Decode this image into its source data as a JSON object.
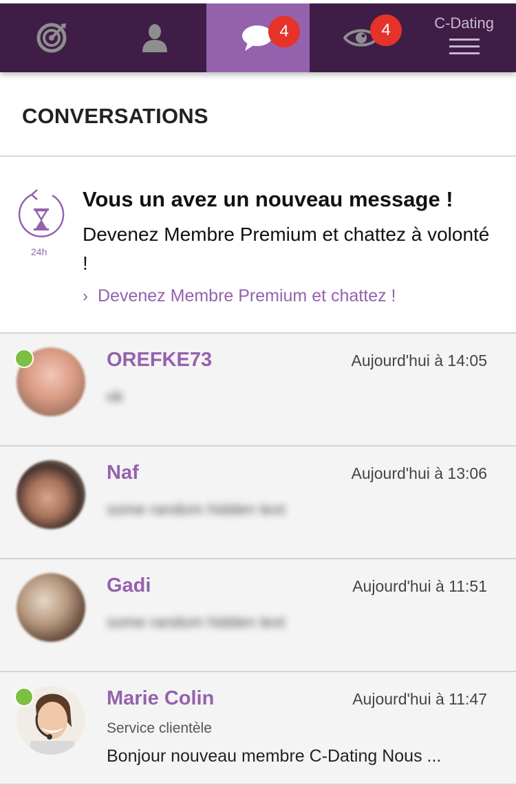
{
  "nav": {
    "brand": "C-Dating",
    "items": [
      {
        "icon": "target-icon",
        "active": false
      },
      {
        "icon": "profile-icon",
        "active": false
      },
      {
        "icon": "chat-icon",
        "active": true,
        "badge": "4"
      },
      {
        "icon": "eye-icon",
        "active": false,
        "badge": "4"
      },
      {
        "icon": "menu-icon",
        "active": false
      }
    ]
  },
  "section": {
    "title": "CONVERSATIONS"
  },
  "promo": {
    "timer_label": "24h",
    "title": "Vous un avez un nouveau message !",
    "text": "Devenez Membre Premium et chattez à volonté !",
    "link": "Devenez Membre Premium et chattez !"
  },
  "conversations": [
    {
      "name": "OREFKE73",
      "time": "Aujourd'hui à 14:05",
      "preview": "ok",
      "online": true
    },
    {
      "name": "Naf",
      "time": "Aujourd'hui à 13:06",
      "preview": "some random hidden text",
      "online": false
    },
    {
      "name": "Gadi",
      "time": "Aujourd'hui à 11:51",
      "preview": "some random hidden text",
      "online": false
    },
    {
      "name": "Marie Colin",
      "subtitle": "Service clientèle",
      "time": "Aujourd'hui à 11:47",
      "preview": "Bonjour nouveau membre C-Dating Nous ...",
      "online": true
    }
  ],
  "colors": {
    "nav_bg": "#3f1d47",
    "nav_active": "#9462ad",
    "accent": "#9462ad",
    "badge": "#e5332a",
    "online": "#7cc043"
  }
}
